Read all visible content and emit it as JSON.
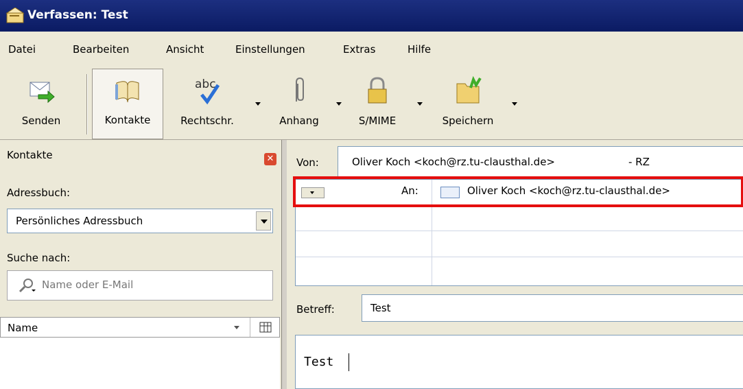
{
  "window": {
    "title": "Verfassen: Test"
  },
  "menu": [
    {
      "label": "Datei"
    },
    {
      "label": "Bearbeiten"
    },
    {
      "label": "Ansicht"
    },
    {
      "label": "Einstellungen"
    },
    {
      "label": "Extras"
    },
    {
      "label": "Hilfe"
    }
  ],
  "toolbar": {
    "send": "Senden",
    "contacts": "Kontakte",
    "spell": "Rechtschr.",
    "spell_icon_text": "abc",
    "attach": "Anhang",
    "smime": "S/MIME",
    "save": "Speichern"
  },
  "sidebar": {
    "title": "Kontakte",
    "addressbook_label": "Adressbuch:",
    "addressbook_value": "Persönliches Adressbuch",
    "search_label": "Suche nach:",
    "search_placeholder": "Name oder E-Mail",
    "column_name": "Name"
  },
  "compose": {
    "from_label": "Von:",
    "from_value": "Oliver Koch <koch@rz.tu-clausthal.de>",
    "from_suffix": "- RZ",
    "to_label": "An:",
    "to_value": "Oliver Koch <koch@rz.tu-clausthal.de>",
    "subject_label": "Betreff:",
    "subject_value": "Test",
    "body": "Test"
  },
  "colors": {
    "highlight": "#e50e0e",
    "titlebar": "#0b1b63"
  }
}
